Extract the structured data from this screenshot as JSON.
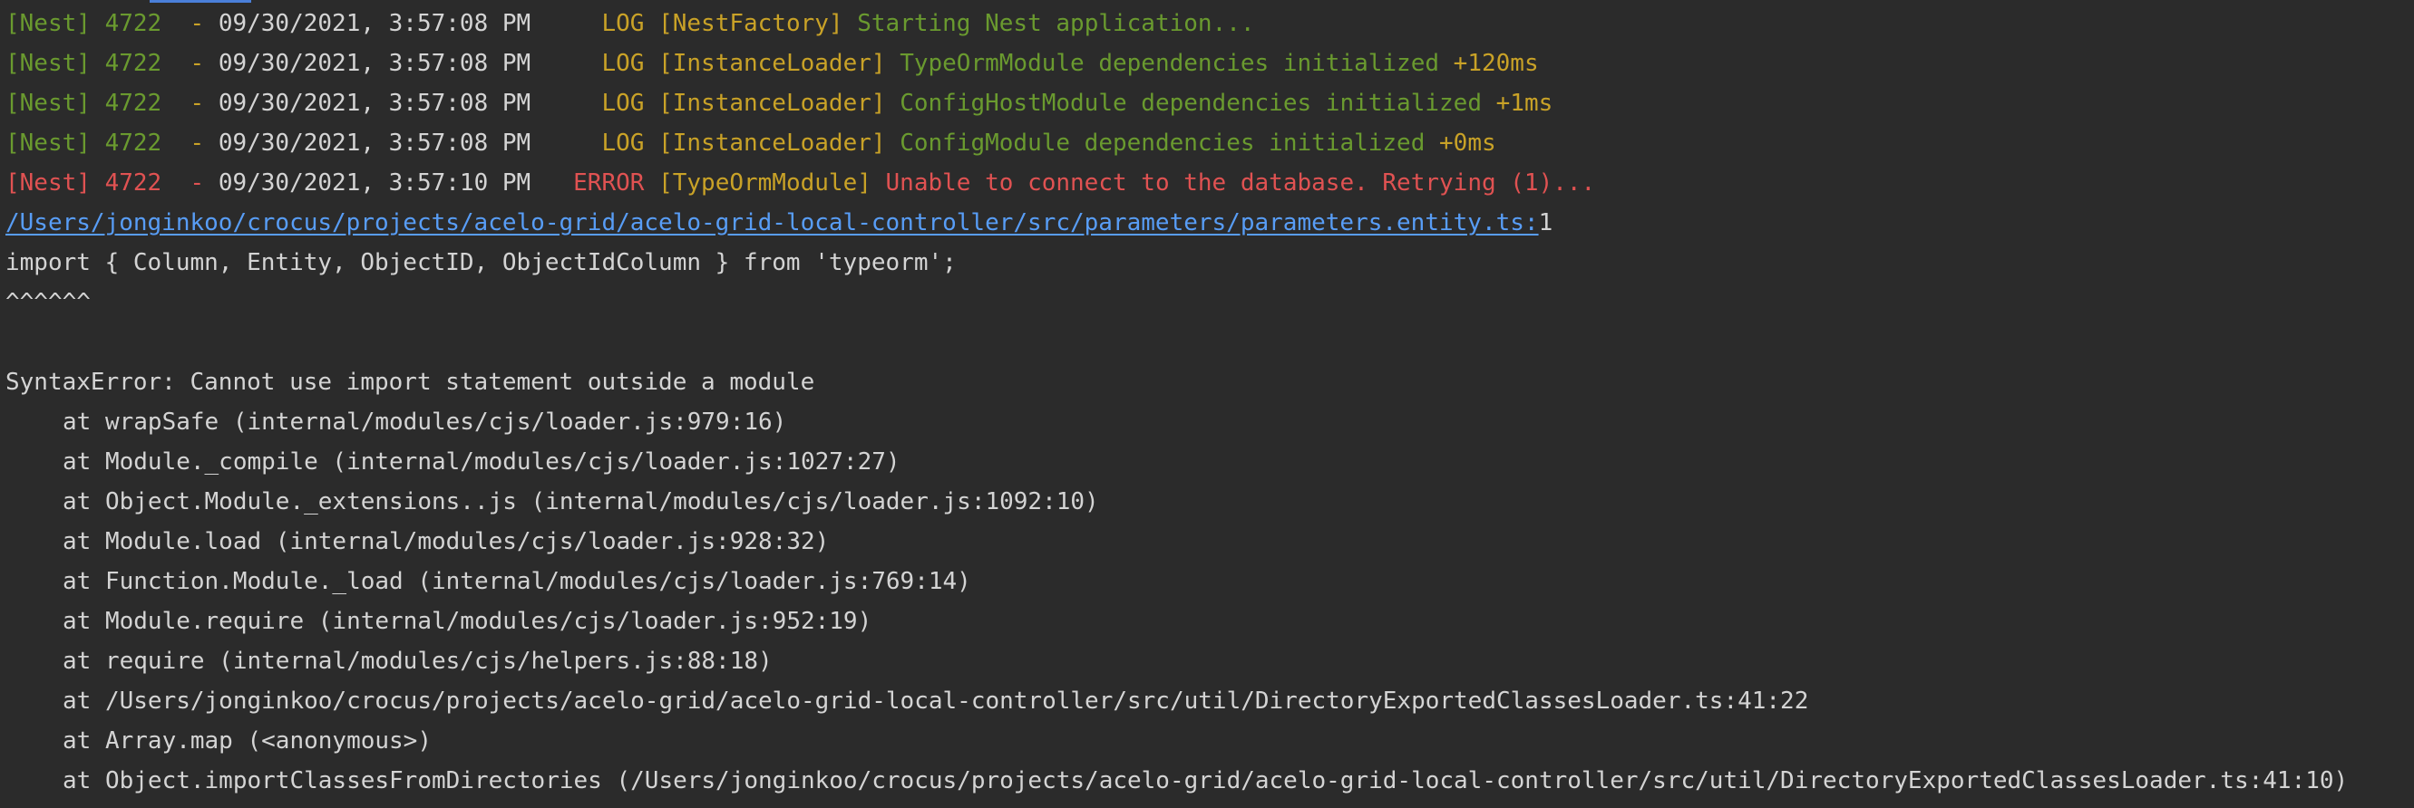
{
  "colors": {
    "background": "#2b2b2b",
    "text": "#d4d4d4",
    "log_green": "#6a9a2f",
    "log_yellow": "#c9a227",
    "error_red": "#e05252",
    "link_blue": "#589df6"
  },
  "logs": [
    {
      "prefix": "[Nest] 4722",
      "sep": "  - ",
      "timestamp": "09/30/2021, 3:57:08 PM",
      "level": "     LOG ",
      "context": "[NestFactory] ",
      "message": "Starting Nest application...",
      "delta": ""
    },
    {
      "prefix": "[Nest] 4722",
      "sep": "  - ",
      "timestamp": "09/30/2021, 3:57:08 PM",
      "level": "     LOG ",
      "context": "[InstanceLoader] ",
      "message": "TypeOrmModule dependencies initialized ",
      "delta": "+120ms"
    },
    {
      "prefix": "[Nest] 4722",
      "sep": "  - ",
      "timestamp": "09/30/2021, 3:57:08 PM",
      "level": "     LOG ",
      "context": "[InstanceLoader] ",
      "message": "ConfigHostModule dependencies initialized ",
      "delta": "+1ms"
    },
    {
      "prefix": "[Nest] 4722",
      "sep": "  - ",
      "timestamp": "09/30/2021, 3:57:08 PM",
      "level": "     LOG ",
      "context": "[InstanceLoader] ",
      "message": "ConfigModule dependencies initialized ",
      "delta": "+0ms"
    }
  ],
  "error_log": {
    "prefix": "[Nest] 4722",
    "sep": "  - ",
    "timestamp": "09/30/2021, 3:57:10 PM",
    "level": "   ERROR ",
    "context": "[TypeOrmModule] ",
    "message": "Unable to connect to the database. Retrying (1)..."
  },
  "file_link": {
    "path": "/Users/jonginkoo/crocus/projects/acelo-grid/acelo-grid-local-controller/src/parameters/parameters.entity.ts:",
    "line": "1"
  },
  "source_line": "import { Column, Entity, ObjectID, ObjectIdColumn } from 'typeorm';",
  "caret_line": "^^^^^^",
  "error_message": "SyntaxError: Cannot use import statement outside a module",
  "stack": [
    "at wrapSafe (internal/modules/cjs/loader.js:979:16)",
    "at Module._compile (internal/modules/cjs/loader.js:1027:27)",
    "at Object.Module._extensions..js (internal/modules/cjs/loader.js:1092:10)",
    "at Module.load (internal/modules/cjs/loader.js:928:32)",
    "at Function.Module._load (internal/modules/cjs/loader.js:769:14)",
    "at Module.require (internal/modules/cjs/loader.js:952:19)",
    "at require (internal/modules/cjs/helpers.js:88:18)",
    "at /Users/jonginkoo/crocus/projects/acelo-grid/acelo-grid-local-controller/src/util/DirectoryExportedClassesLoader.ts:41:22",
    "at Array.map (<anonymous>)",
    "at Object.importClassesFromDirectories (/Users/jonginkoo/crocus/projects/acelo-grid/acelo-grid-local-controller/src/util/DirectoryExportedClassesLoader.ts:41:10)"
  ]
}
